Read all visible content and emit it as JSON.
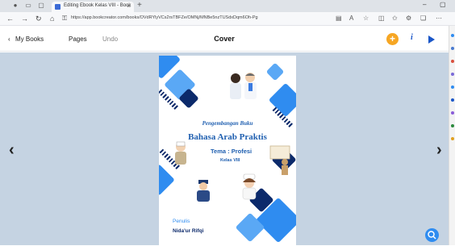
{
  "browser": {
    "tab_title": "Editing Ebook Kelas VIII - Book",
    "url": "https://app.bookcreator.com/books/OVdRYlyVCs2rsTBFZe/OMNj/MNBe5nzTUSdxDqm6Oh-Pg",
    "icons": [
      "profile-icon",
      "workspaces-icon",
      "tabs-icon",
      "back-icon",
      "forward-icon",
      "refresh-icon",
      "lock-icon",
      "reader-icon",
      "read-aloud-icon",
      "favorite-icon",
      "split-screen-icon",
      "favorites-bar-icon",
      "extensions-icon",
      "collections-icon",
      "more-icon"
    ]
  },
  "toolbar": {
    "my_books_label": "My Books",
    "pages_label": "Pages",
    "undo_label": "Undo",
    "title": "Cover",
    "add_label": "+",
    "info_label": "i"
  },
  "cover": {
    "subtitle": "Pengembangan Buku",
    "title": "Bahasa Arab Praktis",
    "theme": "Tema : Profesi",
    "class": "Kelas VIII",
    "writer_label": "Penulis",
    "author": "Nida'ur Rifqi"
  },
  "colors": {
    "accent": "#f6a623",
    "brand_blue": "#1a56c8",
    "canvas": "#c5d3e2",
    "cover_blue": "#2f8cf0",
    "cover_navy": "#0c2a6b"
  }
}
